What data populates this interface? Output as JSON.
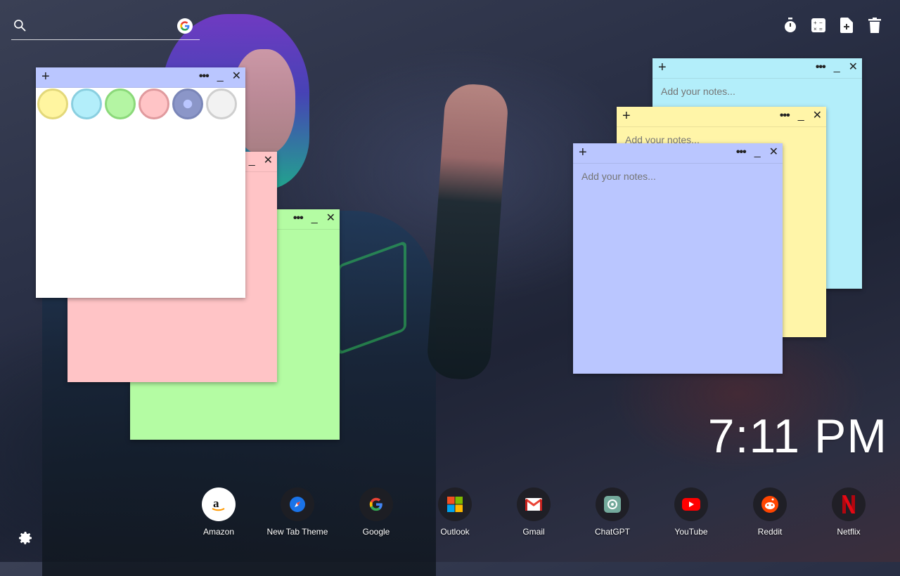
{
  "search": {
    "placeholder": "",
    "value": "",
    "engine_icon": "google-icon"
  },
  "toolbar": {
    "icons": [
      "timer-icon",
      "calculator-icon",
      "add-note-icon",
      "trash-icon"
    ]
  },
  "notes": [
    {
      "color": "#B3EEFA",
      "placeholder": "Add your notes...",
      "plus": "+",
      "more": "•••",
      "minimize": "_",
      "close": "✕"
    },
    {
      "color": "#FFF5A8",
      "placeholder": "Add your notes...",
      "plus": "+",
      "more": "•••",
      "minimize": "_",
      "close": "✕"
    },
    {
      "color": "#BAC6FF",
      "placeholder": "Add your notes...",
      "plus": "+",
      "more": "•••",
      "minimize": "_",
      "close": "✕"
    },
    {
      "color": "#FFC4C6",
      "plus": "+",
      "more": "•••",
      "minimize": "_",
      "close": "✕"
    },
    {
      "color": "#B4FCA3",
      "plus": "+",
      "more": "•••",
      "minimize": "_",
      "close": "✕"
    },
    {
      "color": "#FFFFFF",
      "header_color": "#BAC6FF",
      "plus": "+",
      "more": "•••",
      "minimize": "_",
      "close": "✕"
    }
  ],
  "palette": [
    {
      "name": "yellow",
      "fill": "#FFF5A0",
      "border": "#E3D87A"
    },
    {
      "name": "blue",
      "fill": "#B3EEFA",
      "border": "#8ACFE0"
    },
    {
      "name": "green",
      "fill": "#B4F5A3",
      "border": "#8BD97A"
    },
    {
      "name": "pink",
      "fill": "#FFC4C6",
      "border": "#E09A9E"
    },
    {
      "name": "periwinkle",
      "fill": "#BAC6FF",
      "border": "#8B96C8",
      "selected": true
    },
    {
      "name": "white",
      "fill": "#F2F2F2",
      "border": "#CFCFCF"
    }
  ],
  "clock": {
    "time": "7:11 PM"
  },
  "dock": [
    {
      "label": "Amazon",
      "icon": "amazon-icon"
    },
    {
      "label": "New Tab Theme",
      "icon": "compass-icon"
    },
    {
      "label": "Google",
      "icon": "google-icon"
    },
    {
      "label": "Outlook",
      "icon": "microsoft-icon"
    },
    {
      "label": "Gmail",
      "icon": "gmail-icon"
    },
    {
      "label": "ChatGPT",
      "icon": "chatgpt-icon"
    },
    {
      "label": "YouTube",
      "icon": "youtube-icon"
    },
    {
      "label": "Reddit",
      "icon": "reddit-icon"
    },
    {
      "label": "Netflix",
      "icon": "netflix-icon"
    }
  ],
  "settings": {
    "icon": "gear-icon"
  }
}
